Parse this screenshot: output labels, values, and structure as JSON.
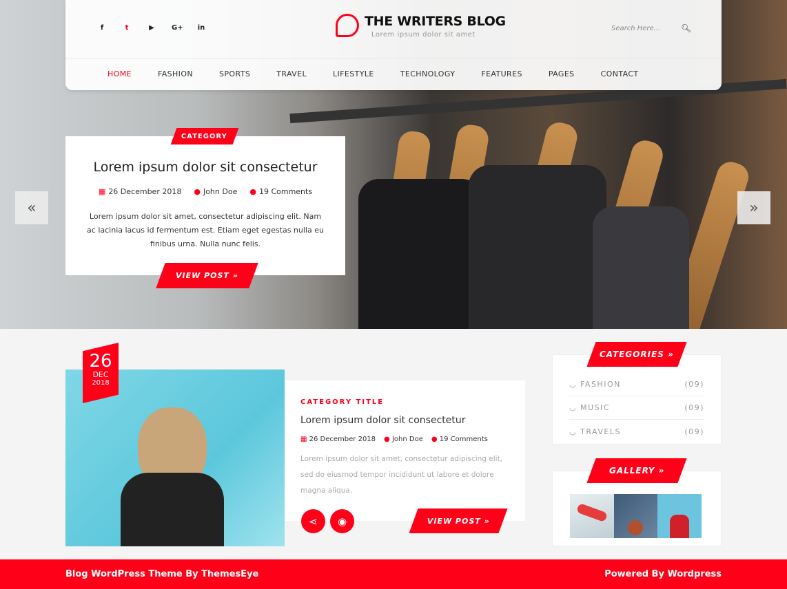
{
  "colors": {
    "accent": "#ff0019"
  },
  "header": {
    "title": "THE WRITERS BLOG",
    "tagline": "Lorem ipsum dolor sit amet",
    "search_placeholder": "Search Here...",
    "social": [
      {
        "icon": "facebook-icon",
        "glyph": "f"
      },
      {
        "icon": "twitter-icon",
        "glyph": "t"
      },
      {
        "icon": "youtube-icon",
        "glyph": "▶"
      },
      {
        "icon": "google-plus-icon",
        "glyph": "G+"
      },
      {
        "icon": "linkedin-icon",
        "glyph": "in"
      }
    ],
    "nav": [
      "HOME",
      "FASHION",
      "SPORTS",
      "TRAVEL",
      "LIFESTYLE",
      "TECHNOLOGY",
      "FEATURES",
      "PAGES",
      "CONTACT"
    ]
  },
  "slider": {
    "category": "CATEGORY",
    "title": "Lorem ipsum dolor sit consectetur",
    "date": "26 December 2018",
    "author": "John Doe",
    "comments": "19 Comments",
    "text": "Lorem ipsum dolor sit amet, consectetur adipiscing elit. Nam ac lacinia lacus id fermentum est. Etiam eget egestas nulla eu finibus urna. Nulla nunc felis.",
    "button": "VIEW POST »",
    "prev": "«",
    "next": "»"
  },
  "post": {
    "day": "26",
    "month": "DEC",
    "year": "2018",
    "category": "CATEGORY TITLE",
    "title": "Lorem ipsum dolor sit consectetur",
    "date": "26 December 2018",
    "author": "John Doe",
    "comments": "19 Comments",
    "text": "Lorem ipsum dolor sit amet, consectetur adipiscing elit, sed do eiusmod tempor incididunt ut labore et dolore magna aliqua.",
    "button": "VIEW POST »"
  },
  "sidebar": {
    "categories_title": "CATEGORIES »",
    "categories": [
      {
        "name": "FASHION",
        "count": "(09)"
      },
      {
        "name": "MUSIC",
        "count": "(09)"
      },
      {
        "name": "TRAVELS",
        "count": "(09)"
      }
    ],
    "gallery_title": "GALLERY »"
  },
  "footer": {
    "left": "Blog WordPress Theme By ThemesEye",
    "right": "Powered By Wordpress"
  }
}
